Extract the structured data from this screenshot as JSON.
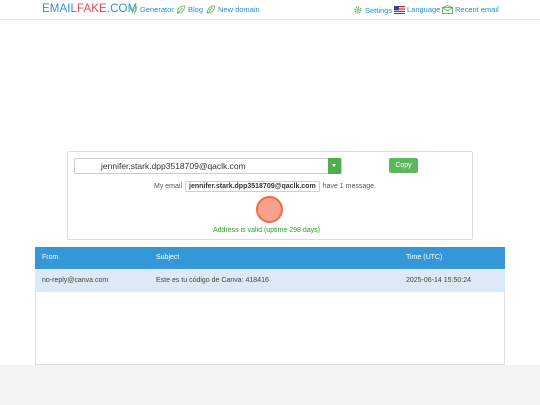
{
  "logo": {
    "part1": "EMAIL",
    "part2": "FAKE",
    "part3": ".COM"
  },
  "nav": {
    "generator": "Generator",
    "blog": "Blog",
    "new_domain": "New domain",
    "settings": "Settings",
    "language": "Language",
    "recent_email": "Recent email"
  },
  "icons": {
    "generator": "antenna-icon",
    "blog": "leaf-icon",
    "new_domain": "leaf-pen-icon",
    "settings": "gear-icon",
    "language": "us-flag-icon",
    "recent_email": "envelope-icon"
  },
  "email_box": {
    "selected_email": "jennifer.stark.dpp3518709@qaclk.com",
    "copy_label": "Copy",
    "my_email_label": "My email",
    "my_email_value": "jennifer.stark.dpp3518709@qaclk.com",
    "message_count_text": "have 1 message.",
    "valid_text": "Address is valid (uptime 298 days)"
  },
  "table": {
    "headers": {
      "from": "From",
      "subject": "Subject",
      "time": "Time (UTC)"
    },
    "rows": [
      {
        "from": "no-reply@canva.com",
        "subject": "Este es tu código de Canva: 418416",
        "time": "2025-06-14 15:50:24"
      }
    ]
  },
  "colors": {
    "brand_blue": "#2f8fd8",
    "brand_red": "#e8474a",
    "table_header": "#3697d8",
    "row_highlight": "#dbeaf6",
    "success_green": "#5cb85c"
  }
}
